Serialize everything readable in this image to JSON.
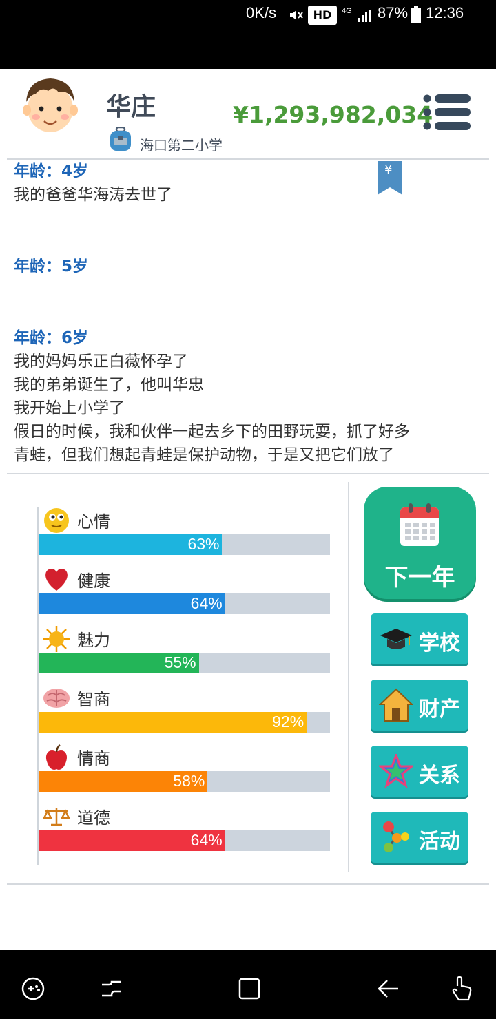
{
  "status_bar": {
    "speed": "0K/s",
    "hd": "HD",
    "network": "4G",
    "battery": "87%",
    "time": "12:36"
  },
  "header": {
    "name": "华庄",
    "school": "海口第二小学",
    "money": "¥1,293,982,034",
    "bookmark_symbol": "¥"
  },
  "log": [
    {
      "age": "年龄：4岁",
      "events": [
        "我的爸爸华海涛去世了"
      ]
    },
    {
      "age": "年龄：5岁",
      "events": []
    },
    {
      "age": "年龄：6岁",
      "events": [
        "我的妈妈乐正白薇怀孕了",
        "我的弟弟诞生了，他叫华忠",
        "我开始上小学了",
        "假日的时候，我和伙伴一起去乡下的田野玩耍，抓了好多",
        "青蛙，但我们想起青蛙是保护动物，于是又把它们放了"
      ]
    }
  ],
  "stats": [
    {
      "label": "心情",
      "value": 63,
      "pct": "63%",
      "color": "#1db4de",
      "icon": "smiley-icon"
    },
    {
      "label": "健康",
      "value": 64,
      "pct": "64%",
      "color": "#1e88dd",
      "icon": "heart-icon"
    },
    {
      "label": "魅力",
      "value": 55,
      "pct": "55%",
      "color": "#23b558",
      "icon": "sun-icon"
    },
    {
      "label": "智商",
      "value": 92,
      "pct": "92%",
      "color": "#fcb80a",
      "icon": "brain-icon"
    },
    {
      "label": "情商",
      "value": 58,
      "pct": "58%",
      "color": "#fc8406",
      "icon": "apple-icon"
    },
    {
      "label": "道德",
      "value": 64,
      "pct": "64%",
      "color": "#ef3340",
      "icon": "scales-icon"
    }
  ],
  "buttons": {
    "next_year": "下一年",
    "school": "学校",
    "property": "财产",
    "relations": "关系",
    "activities": "活动"
  }
}
